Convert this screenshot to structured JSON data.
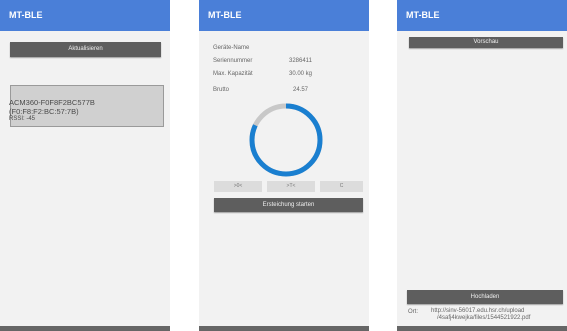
{
  "screen1": {
    "title": "MT-BLE",
    "refresh_label": "Aktualisieren",
    "device": {
      "name": "ACM360-F0F8F2BC577B",
      "address": "(F0:F8:F2:BC:57:7B)",
      "rssi": "RSSI: -45"
    }
  },
  "screen2": {
    "title": "MT-BLE",
    "device_name_label": "Geräte-Name",
    "serial_label": "Seriennummer",
    "serial_value": "3286411",
    "capacity_label": "Max. Kapazität",
    "capacity_value": "30.00 kg",
    "gross_label": "Brutto",
    "gross_value": "24.57",
    "gauge_fraction": 0.82,
    "zero_label": ">0<",
    "tare_label": ">T<",
    "clear_label": "C",
    "calibration_label": "Ersteichung starten"
  },
  "screen3": {
    "title": "MT-BLE",
    "preview_label": "Vorschau",
    "upload_label": "Hochladen",
    "location_label": "Ort:",
    "location_url_line1": "http://sinv-56017.edu.hsr.ch/upload",
    "location_url_line2": "/4safj4kwejka/files/1544521922.pdf"
  },
  "colors": {
    "appbar": "#4a7fd8",
    "button": "#5e5e5e",
    "gauge_fill": "#1a7fd0",
    "gauge_track": "#c8c8c8"
  }
}
